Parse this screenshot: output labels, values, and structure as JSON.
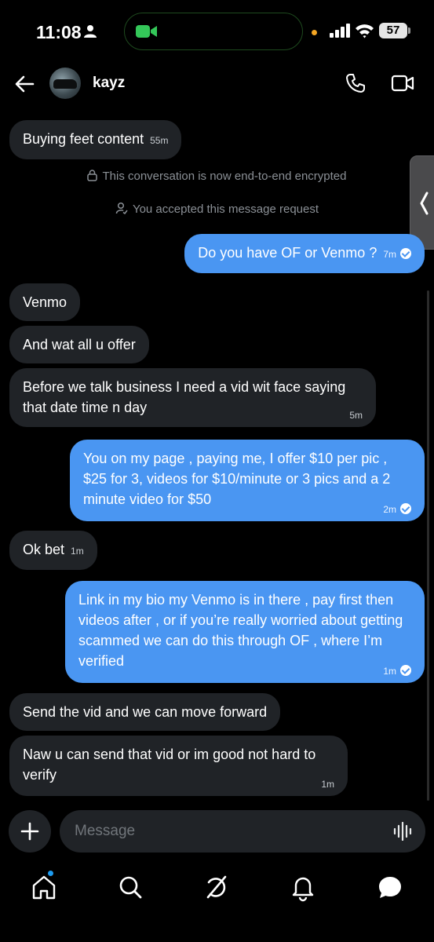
{
  "status_bar": {
    "time": "11:08",
    "battery": "57",
    "icons": [
      "person-icon",
      "facetime-camera-icon",
      "signal-icon",
      "wifi-icon",
      "battery-icon"
    ]
  },
  "header": {
    "username": "kayz",
    "icons": [
      "back-arrow-icon",
      "phone-icon",
      "video-camera-icon"
    ]
  },
  "messages": [
    {
      "dir": "in",
      "text": "Buying feet content",
      "time": "55m"
    },
    {
      "dir": "in",
      "text": "Venmo",
      "time": ""
    },
    {
      "dir": "in",
      "text": "And wat all u offer",
      "time": ""
    },
    {
      "dir": "in",
      "text": "Before we talk business I need a vid wit face saying that date time n day",
      "time": "5m"
    },
    {
      "dir": "in",
      "text": "Ok bet",
      "time": "1m"
    },
    {
      "dir": "in",
      "text": "Send the vid and we can move forward",
      "time": ""
    },
    {
      "dir": "in",
      "text": "Naw u can send that vid or im good not hard to verify",
      "time": "1m"
    },
    {
      "dir": "out",
      "text": "Do you have OF or Venmo ?",
      "time": "7m",
      "seen": true
    },
    {
      "dir": "out",
      "text": "You on my page , paying me, I offer $10 per pic , $25 for 3, videos for $10/minute or 3 pics and a 2 minute video for $50",
      "time": "2m",
      "seen": true
    },
    {
      "dir": "out",
      "text": "Link in my bio my Venmo is in there , pay first then videos after , or if you’re really worried about getting scammed we can do this through OF , where I’m verified",
      "time": "1m",
      "seen": true
    }
  ],
  "system": {
    "encrypted": "This conversation is now end-to-end encrypted",
    "accepted": "You accepted this message request"
  },
  "composer": {
    "placeholder": "Message",
    "icons": [
      "plus-icon",
      "voice-wave-icon"
    ]
  },
  "nav": {
    "items": [
      "home-icon",
      "search-icon",
      "grok-icon",
      "notifications-icon",
      "messages-icon"
    ],
    "home_has_notification": true
  },
  "colors": {
    "background": "#000000",
    "incoming_bubble": "#202327",
    "outgoing_bubble": "#4a96f2",
    "accent": "#1d9bf0"
  }
}
